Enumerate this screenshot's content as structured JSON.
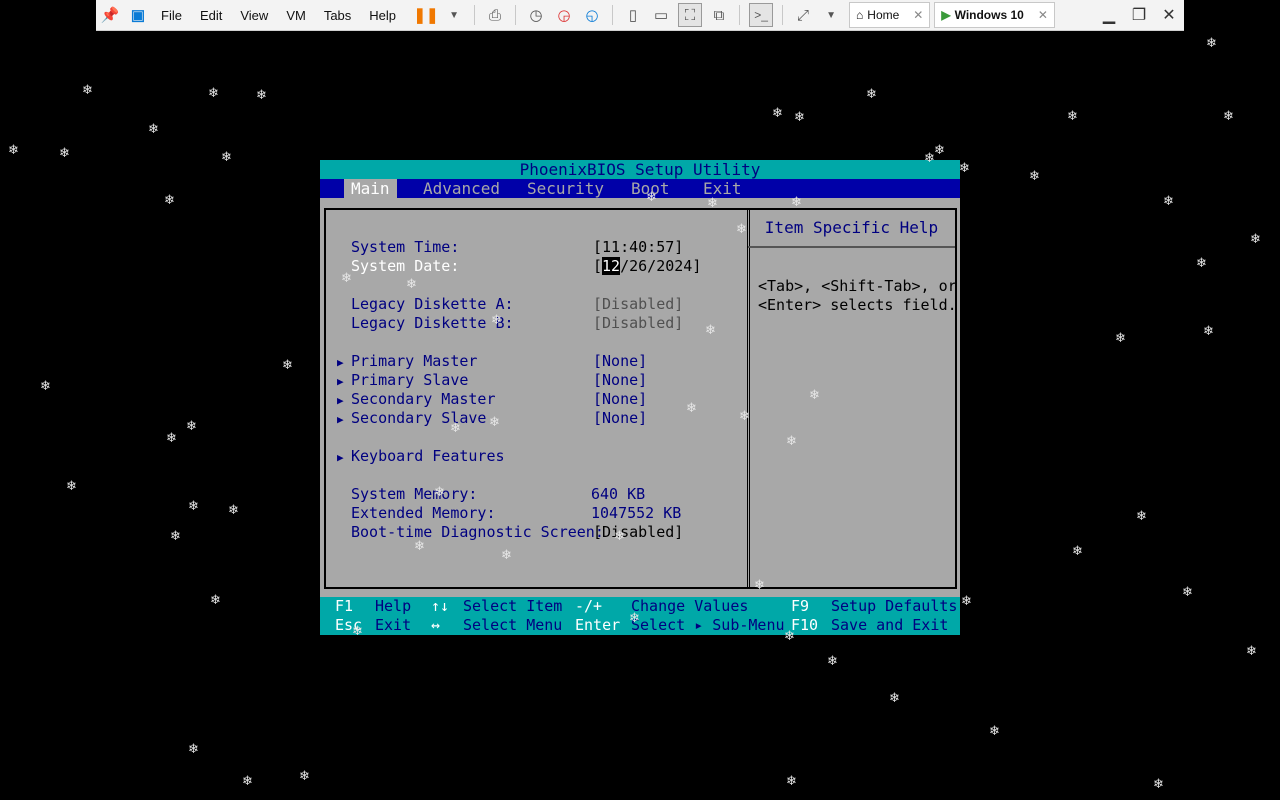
{
  "toolbar": {
    "menus": [
      "File",
      "Edit",
      "View",
      "VM",
      "Tabs",
      "Help"
    ],
    "tabs": [
      {
        "label": "Home"
      },
      {
        "label": "Windows 10"
      }
    ]
  },
  "bios": {
    "title": "PhoenixBIOS Setup Utility",
    "menu": [
      "Main",
      "Advanced",
      "Security",
      "Boot",
      "Exit"
    ],
    "fields": {
      "system_time_label": "System Time:",
      "system_time_value": "[11:40:57]",
      "system_date_label": "System Date:",
      "system_date_open": "[",
      "system_date_month": "12",
      "system_date_rest": "/26/2024]",
      "diskette_a_label": "Legacy Diskette A:",
      "diskette_a_value": "[Disabled]",
      "diskette_b_label": "Legacy Diskette B:",
      "diskette_b_value": "[Disabled]",
      "primary_master_label": "Primary Master",
      "primary_master_value": "[None]",
      "primary_slave_label": "Primary Slave",
      "primary_slave_value": "[None]",
      "secondary_master_label": "Secondary Master",
      "secondary_master_value": "[None]",
      "secondary_slave_label": "Secondary Slave",
      "secondary_slave_value": "[None]",
      "keyboard_label": "Keyboard Features",
      "system_memory_label": "System Memory:",
      "system_memory_value": "640 KB",
      "extended_memory_label": "Extended Memory:",
      "extended_memory_value": "1047552 KB",
      "boot_diag_label": "Boot-time Diagnostic Screen:",
      "boot_diag_value": "[Disabled]"
    },
    "help": {
      "title": "Item Specific Help",
      "text": "<Tab>, <Shift-Tab>, or\n<Enter> selects field."
    },
    "status": {
      "f1_key": "F1",
      "f1_desc": "Help",
      "updown_key": "↑↓",
      "updown_desc": "Select Item",
      "plusminus_key": "-/+",
      "plusminus_desc": "Change Values",
      "f9_key": "F9",
      "f9_desc": "Setup Defaults",
      "esc_key": "Esc",
      "esc_desc": "Exit",
      "leftright_key": "↔",
      "leftright_desc": "Select Menu",
      "enter_key": "Enter",
      "enter_desc": "Select ▸ Sub-Menu",
      "f10_key": "F10",
      "f10_desc": "Save and Exit"
    }
  },
  "colors": {
    "bios_gray": "#a8a8a8",
    "bios_cyan": "#00a8a8",
    "bios_blue": "#0000a8",
    "bios_label": "#000080"
  },
  "icons": [
    "pin-icon",
    "vmware-logo-icon",
    "pause-icon",
    "dropdown-icon",
    "send-keys-icon",
    "snapshot-icon",
    "revert-snapshot-icon",
    "snapshot-manager-icon",
    "sidebar-icon",
    "thumbnail-icon",
    "fullscreen-icon",
    "unity-icon",
    "console-icon",
    "stretch-icon",
    "home-icon",
    "vm-icon",
    "close-icon",
    "minimize-icon",
    "restore-icon",
    "window-close-icon",
    "snowflake-icon"
  ]
}
